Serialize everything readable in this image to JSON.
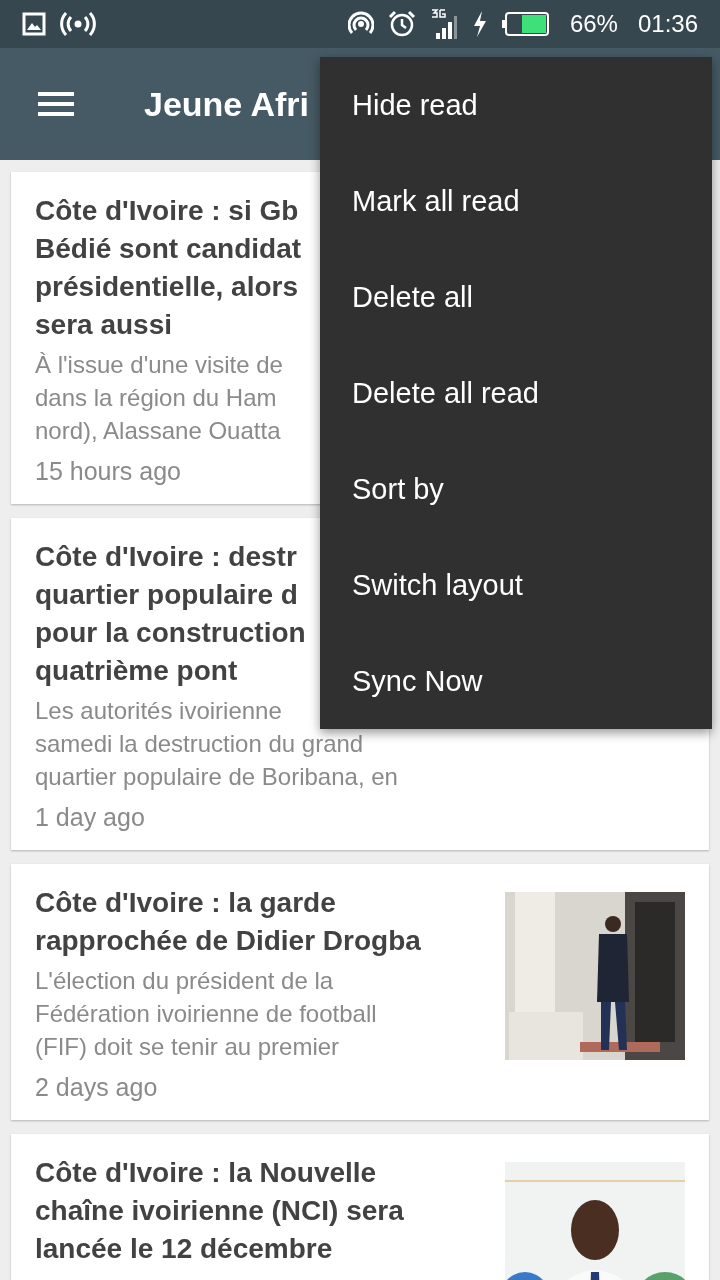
{
  "status_bar": {
    "battery": "66%",
    "time": "01:36"
  },
  "app_bar": {
    "title": "Jeune Afri"
  },
  "cards": [
    {
      "title_lines": [
        "Côte d'Ivoire : si Gb",
        "Bédié sont candidat",
        "présidentielle, alors",
        "sera aussi"
      ],
      "excerpt_lines": [
        "À l'issue d'une visite de",
        "dans la région du Ham",
        "nord), Alassane Ouatta"
      ],
      "time": "15 hours ago"
    },
    {
      "title_lines": [
        "Côte d'Ivoire : destr",
        "quartier populaire d",
        "pour la construction",
        "quatrième pont"
      ],
      "excerpt_lines": [
        "Les autorités ivoirienne",
        "samedi la destruction du grand",
        "quartier populaire de Boribana, en"
      ],
      "time": "1 day ago"
    },
    {
      "title_lines": [
        "Côte d'Ivoire : la garde",
        "rapprochée de Didier Drogba"
      ],
      "excerpt_lines": [
        "L'élection du président de la",
        "Fédération ivoirienne de football",
        "(FIF) doit se tenir au premier"
      ],
      "time": "2 days ago",
      "image": {
        "kind": "picture"
      }
    },
    {
      "title_lines": [
        "Côte d'Ivoire : la Nouvelle",
        "chaîne ivoirienne (NCI) sera",
        "lancée le 12 décembre"
      ],
      "image": {
        "kind": "picture"
      }
    }
  ],
  "menu": {
    "items": [
      "Hide read",
      "Mark all read",
      "Delete all",
      "Delete all read",
      "Sort by",
      "Switch layout",
      "Sync Now"
    ]
  }
}
